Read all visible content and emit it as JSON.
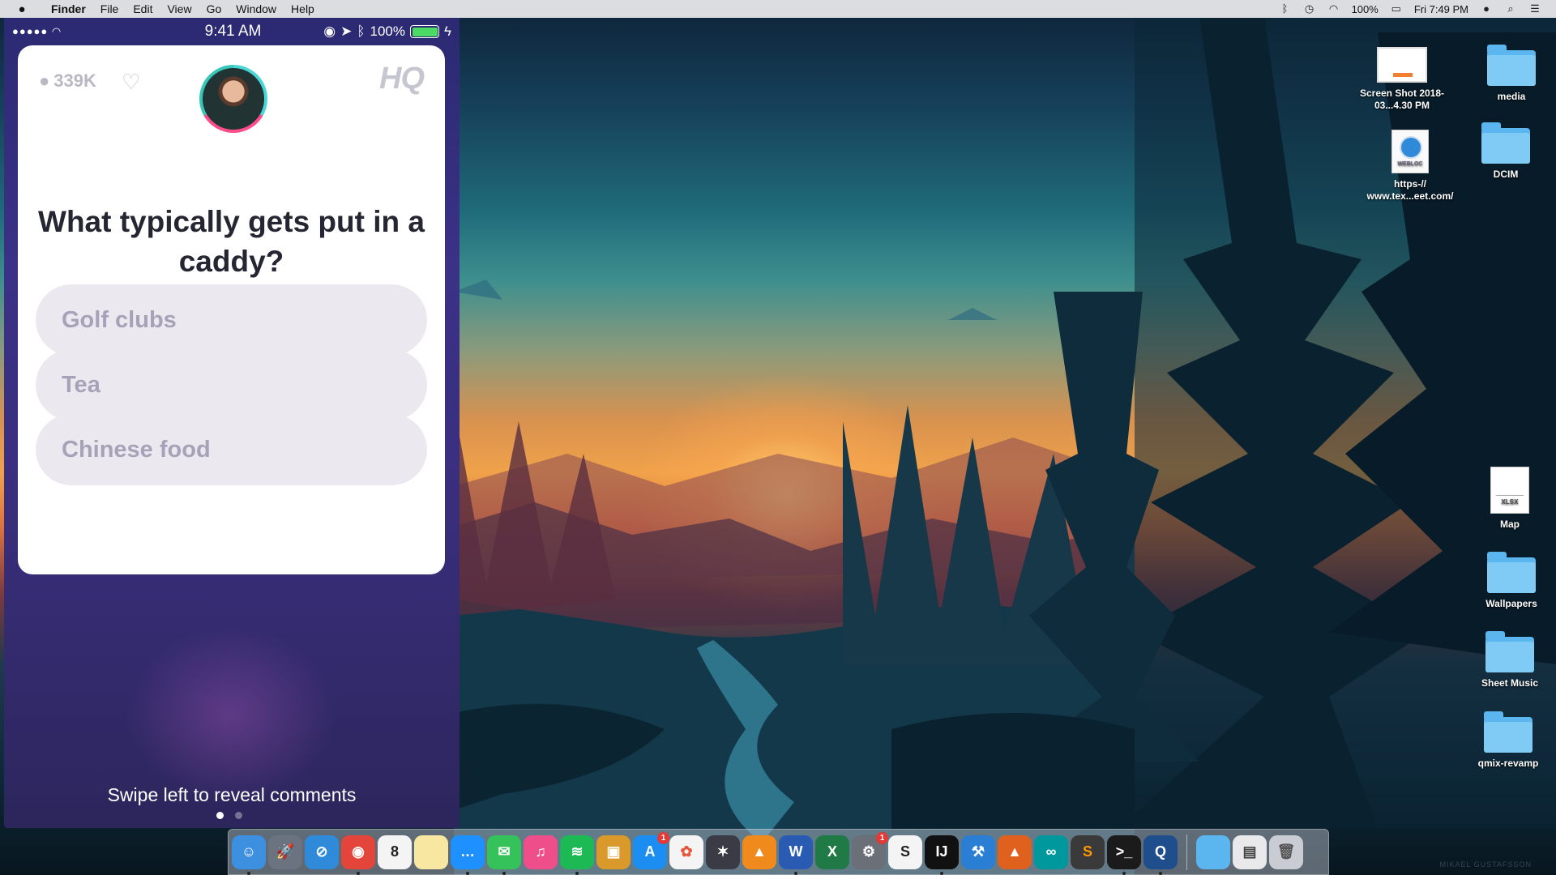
{
  "menubar": {
    "app_name": "Finder",
    "menus": [
      "File",
      "Edit",
      "View",
      "Go",
      "Window",
      "Help"
    ],
    "battery": "100%",
    "clock": "Fri 7:49 PM"
  },
  "phone": {
    "status_time": "9:41 AM",
    "battery": "100%",
    "viewer_count": "339K",
    "logo": "HQ",
    "question": "What typically gets put in a caddy?",
    "answers": [
      "Golf clubs",
      "Tea",
      "Chinese food"
    ],
    "swipe_hint": "Swipe left to reveal comments",
    "page_count": 2,
    "current_page": 1
  },
  "desktop_icons": [
    {
      "label": "media",
      "kind": "folder"
    },
    {
      "label": "DCIM",
      "kind": "folder"
    },
    {
      "label": "Screen Shot 2018-03...4.30 PM",
      "kind": "screenshot"
    },
    {
      "label": "https-// www.tex...eet.com/",
      "kind": "webloc",
      "badge": "WEBLOC"
    },
    {
      "label": "Map",
      "kind": "xlsx",
      "badge": "XLSX"
    },
    {
      "label": "Wallpapers",
      "kind": "folder"
    },
    {
      "label": "Sheet Music",
      "kind": "folder"
    },
    {
      "label": "qmix-revamp",
      "kind": "folder"
    }
  ],
  "dock": {
    "apps": [
      {
        "name": "finder-icon",
        "glyph": "☺",
        "color": "#3d8fe0",
        "running": true
      },
      {
        "name": "launchpad-icon",
        "glyph": "🚀",
        "color": "#6b7380"
      },
      {
        "name": "safari-icon",
        "glyph": "⊘",
        "color": "#2f8bd9"
      },
      {
        "name": "chrome-icon",
        "glyph": "◉",
        "color": "#e3453b",
        "running": true
      },
      {
        "name": "calendar-icon",
        "glyph": "8",
        "color": "#f4f4f4",
        "text_color": "#222"
      },
      {
        "name": "notes-icon",
        "glyph": "",
        "color": "#f7e7a0"
      },
      {
        "name": "messenger-icon",
        "glyph": "…",
        "color": "#1e90ff",
        "running": true
      },
      {
        "name": "messages-icon",
        "glyph": "✉",
        "color": "#36c25a",
        "running": true
      },
      {
        "name": "itunes-icon",
        "glyph": "♫",
        "color": "#ee4f8a"
      },
      {
        "name": "spotify-icon",
        "glyph": "≋",
        "color": "#1db954",
        "running": true
      },
      {
        "name": "preview-icon",
        "glyph": "▣",
        "color": "#d99a2b"
      },
      {
        "name": "app-store-icon",
        "glyph": "A",
        "color": "#1c8ef2",
        "badge": "1"
      },
      {
        "name": "photos-icon",
        "glyph": "✿",
        "color": "#f4f4f4",
        "text_color": "#e8573d"
      },
      {
        "name": "final-cut-icon",
        "glyph": "✶",
        "color": "#3b3b46"
      },
      {
        "name": "vlc-icon",
        "glyph": "▲",
        "color": "#f08a1c"
      },
      {
        "name": "word-icon",
        "glyph": "W",
        "color": "#2a5bb3",
        "running": true
      },
      {
        "name": "excel-icon",
        "glyph": "X",
        "color": "#1f7a45"
      },
      {
        "name": "system-preferences-icon",
        "glyph": "⚙",
        "color": "#6b6f78",
        "badge": "1"
      },
      {
        "name": "scrivener-icon",
        "glyph": "S",
        "color": "#f4f4f4",
        "text_color": "#222"
      },
      {
        "name": "intellij-icon",
        "glyph": "IJ",
        "color": "#111",
        "running": true
      },
      {
        "name": "xcode-icon",
        "glyph": "⚒",
        "color": "#2a7fd4"
      },
      {
        "name": "matlab-icon",
        "glyph": "▲",
        "color": "#e0601d"
      },
      {
        "name": "arduino-icon",
        "glyph": "∞",
        "color": "#00979d"
      },
      {
        "name": "sublime-text-icon",
        "glyph": "S",
        "color": "#3a3a3a",
        "text_color": "#ff9800"
      },
      {
        "name": "terminal-icon",
        "glyph": ">_",
        "color": "#1b1b1b",
        "running": true
      },
      {
        "name": "quicktime-icon",
        "glyph": "Q",
        "color": "#1f4e8c",
        "running": true
      }
    ],
    "right": [
      {
        "name": "downloads-folder-icon",
        "glyph": "",
        "color": "#5bb5ee"
      },
      {
        "name": "documents-stack-icon",
        "glyph": "▤",
        "color": "#e9e9ec",
        "text_color": "#444"
      },
      {
        "name": "trash-icon",
        "glyph": "🗑",
        "color": "#c9ccd3",
        "text_color": "#555"
      }
    ]
  },
  "watermark": "MIKAEL GUSTAFSSON",
  "colors": {
    "phone_bg": "#3a2f80",
    "answer_bg": "#ebe9ef",
    "answer_text": "#a6a3b8",
    "menubar": "#ececee"
  }
}
